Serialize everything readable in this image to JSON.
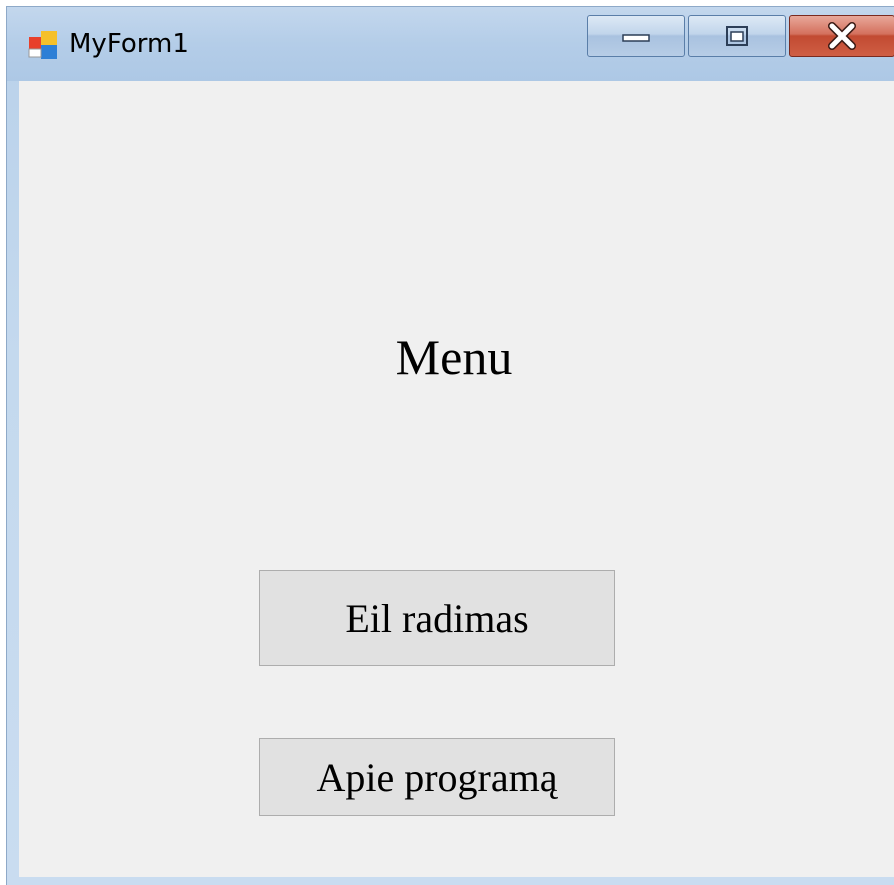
{
  "window": {
    "title": "MyForm1",
    "icon": "winforms-app-icon",
    "controls": {
      "minimize_icon": "minimize-icon",
      "maximize_icon": "maximize-icon",
      "close_icon": "close-icon"
    }
  },
  "form": {
    "heading": "Menu",
    "buttons": [
      {
        "label": "Eil radimas"
      },
      {
        "label": "Apie programą"
      }
    ]
  },
  "colors": {
    "client_background": "#f0f0f0",
    "button_face": "#e1e1e1",
    "button_border": "#adadad",
    "close_button": "#c9503a",
    "titlebar": "#b9d1ea"
  }
}
